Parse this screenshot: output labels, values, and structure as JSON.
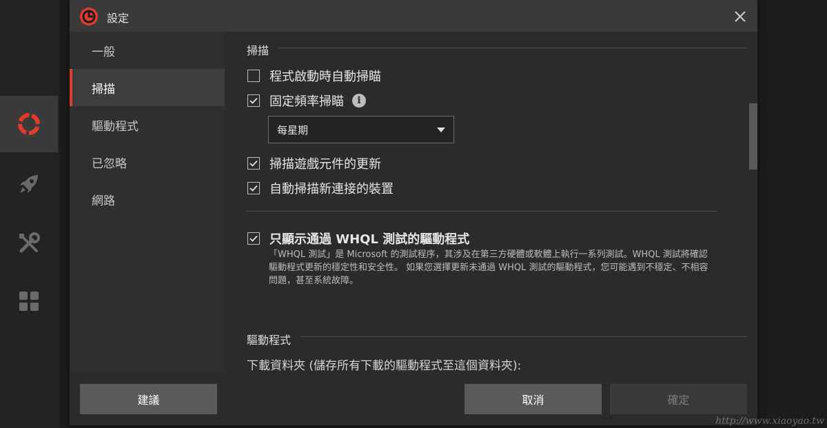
{
  "window": {
    "title": "設定"
  },
  "sidebar": {
    "items": [
      {
        "label": "一般",
        "active": false
      },
      {
        "label": "掃描",
        "active": true
      },
      {
        "label": "驅動程式",
        "active": false
      },
      {
        "label": "已忽略",
        "active": false
      },
      {
        "label": "網路",
        "active": false
      }
    ]
  },
  "scan": {
    "header": "掃描",
    "auto_scan_on_start": {
      "label": "程式啟動時自動掃瞄",
      "checked": false
    },
    "scheduled_scan": {
      "label": "固定頻率掃瞄",
      "checked": true
    },
    "frequency": {
      "selected": "每星期"
    },
    "scan_game_components": {
      "label": "掃描遊戲元件的更新",
      "checked": true
    },
    "auto_scan_new_devices": {
      "label": "自動掃描新連接的裝置",
      "checked": true
    },
    "whql_only": {
      "label": "只顯示通過 WHQL 測試的驅動程式",
      "checked": true
    },
    "whql_desc": "「WHQL 測試」是 Microsoft 的測試程序，其涉及在第三方硬體或軟體上執行一系列測試。WHQL 測試將確認驅動程式更新的穩定性和安全性。 如果您選擇更新未通過 WHQL 測試的驅動程式，您可能遇到不穩定、不相容問題，甚至系統故障。"
  },
  "driver": {
    "header": "驅動程式",
    "folder_label": "下載資料夾 (儲存所有下載的驅動程式至這個資料夾):"
  },
  "footer": {
    "suggest_label": "建議",
    "cancel_label": "取消",
    "ok_label": "確定"
  },
  "watermark": "http://www.xiaoyao.tw",
  "colors": {
    "accent": "#e23a2b",
    "background": "#2b2b2b",
    "titlebar": "#3a3a3a"
  }
}
